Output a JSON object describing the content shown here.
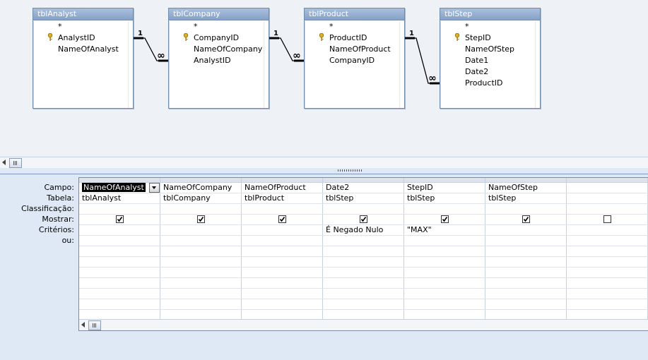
{
  "tables": [
    {
      "name": "tblAnalyst",
      "fields": [
        "*",
        "AnalystID",
        "NameOfAnalyst"
      ],
      "key_index": 1
    },
    {
      "name": "tblCompany",
      "fields": [
        "*",
        "CompanyID",
        "NameOfCompany",
        "AnalystID"
      ],
      "key_index": 1
    },
    {
      "name": "tblProduct",
      "fields": [
        "*",
        "ProductID",
        "NameOfProduct",
        "CompanyID"
      ],
      "key_index": 1
    },
    {
      "name": "tblStep",
      "fields": [
        "*",
        "StepID",
        "NameOfStep",
        "Date1",
        "Date2",
        "ProductID"
      ],
      "key_index": 1
    }
  ],
  "relationships": [
    {
      "one": "1",
      "many": "∞"
    },
    {
      "one": "1",
      "many": "∞"
    },
    {
      "one": "1",
      "many": "∞"
    }
  ],
  "row_labels": {
    "field": "Campo:",
    "table": "Tabela:",
    "sort": "Classificação:",
    "show": "Mostrar:",
    "criteria": "Critérios:",
    "or": "ou:"
  },
  "columns": [
    {
      "field": "NameOfAnalyst",
      "table": "tblAnalyst",
      "show": true,
      "criteria": "",
      "selected": true
    },
    {
      "field": "NameOfCompany",
      "table": "tblCompany",
      "show": true,
      "criteria": ""
    },
    {
      "field": "NameOfProduct",
      "table": "tblProduct",
      "show": true,
      "criteria": ""
    },
    {
      "field": "Date2",
      "table": "tblStep",
      "show": true,
      "criteria": "É Negado Nulo"
    },
    {
      "field": "StepID",
      "table": "tblStep",
      "show": true,
      "criteria": "\"MAX\""
    },
    {
      "field": "NameOfStep",
      "table": "tblStep",
      "show": true,
      "criteria": ""
    },
    {
      "field": "",
      "table": "",
      "show": false,
      "criteria": ""
    }
  ],
  "colors": {
    "title_bar": "#87a2c7",
    "border": "#6f8bb0",
    "background": "#dfe9f5"
  },
  "icons": [
    "key-icon",
    "dropdown-arrow-icon",
    "scroll-left-icon",
    "checkbox-checked-icon",
    "checkbox-empty-icon"
  ]
}
